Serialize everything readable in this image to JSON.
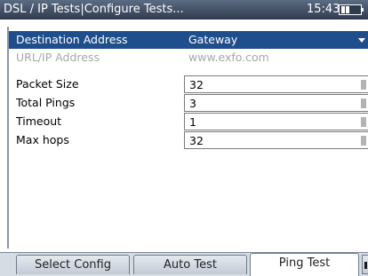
{
  "titlebar": {
    "title": "DSL / IP Tests|Configure Tests...",
    "time": "15:43"
  },
  "form": {
    "rows": [
      {
        "label": "Destination Address",
        "value": "Gateway"
      },
      {
        "label": "URL/IP Address",
        "value": "www.exfo.com"
      },
      {
        "label": "Packet Size",
        "value": "32"
      },
      {
        "label": "Total Pings",
        "value": "3"
      },
      {
        "label": "Timeout",
        "value": "1"
      },
      {
        "label": "Max hops",
        "value": "32"
      }
    ]
  },
  "tabs": [
    {
      "label": "Select Config"
    },
    {
      "label": "Auto Test"
    },
    {
      "label": "Ping Test"
    }
  ],
  "colors": {
    "title_bar": "#2f3b4f",
    "selected_row": "#1f4e8c",
    "disabled_text": "#a7a7a7"
  }
}
